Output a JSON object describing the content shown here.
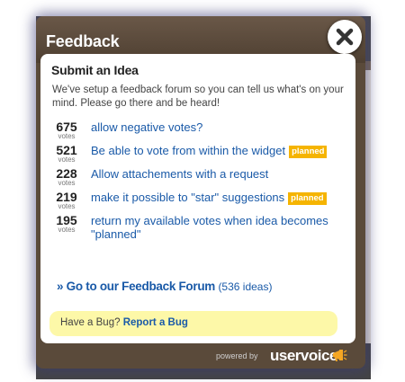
{
  "window": {
    "title": "Feedback"
  },
  "panel": {
    "title": "Submit an Idea",
    "description": "We've setup a feedback forum so you can tell us what's on your mind. Please go there and be heard!"
  },
  "ideas": [
    {
      "votes": "675",
      "votes_label": "votes",
      "title": "allow negative votes?",
      "status": ""
    },
    {
      "votes": "521",
      "votes_label": "votes",
      "title": "Be able to vote from within the widget",
      "status": "planned"
    },
    {
      "votes": "228",
      "votes_label": "votes",
      "title": "Allow attachements with a request",
      "status": ""
    },
    {
      "votes": "219",
      "votes_label": "votes",
      "title": "make it possible to \"star\" suggestions",
      "status": "planned"
    },
    {
      "votes": "195",
      "votes_label": "votes",
      "title": "return my available votes when idea becomes \"planned\"",
      "status": ""
    }
  ],
  "forum_link": {
    "label": "» Go to our Feedback Forum",
    "count": "(536 ideas)"
  },
  "bug": {
    "prompt": "Have a Bug?",
    "link": "Report a Bug"
  },
  "footer": {
    "powered_by": "powered by",
    "brand": "uservoice"
  },
  "colors": {
    "link": "#1a5aa8",
    "badge": "#f5b400",
    "bug_bg": "#fdf8a8",
    "frame": "#5a4a3a"
  },
  "icons": {
    "close": "close-icon",
    "megaphone": "megaphone-icon"
  }
}
